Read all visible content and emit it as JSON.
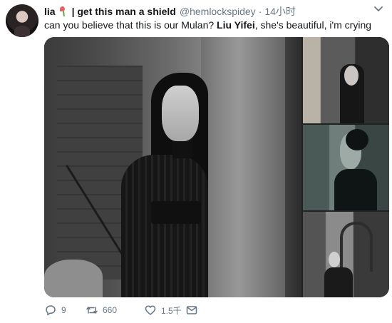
{
  "tweet": {
    "display_name": "lia",
    "display_name_suffix": "| get this man a shield",
    "handle": "@hemlockspidey",
    "separator": "·",
    "time": "14小时",
    "text_before": "can you believe that this is our Mulan? ",
    "text_bold": "Liu Yifei",
    "text_after": ", she's beautiful, i'm crying"
  },
  "actions": {
    "reply_count": "9",
    "retweet_count": "660",
    "like_count": "1.5千"
  },
  "icons": {
    "avatar": "avatar",
    "emoji": "rose-emoji",
    "more": "chevron-down-icon",
    "reply": "reply-icon",
    "retweet": "retweet-icon",
    "like": "heart-icon",
    "dm": "direct-message-icon"
  },
  "colors": {
    "text": "#14171a",
    "secondary": "#657786",
    "background": "#ffffff"
  }
}
